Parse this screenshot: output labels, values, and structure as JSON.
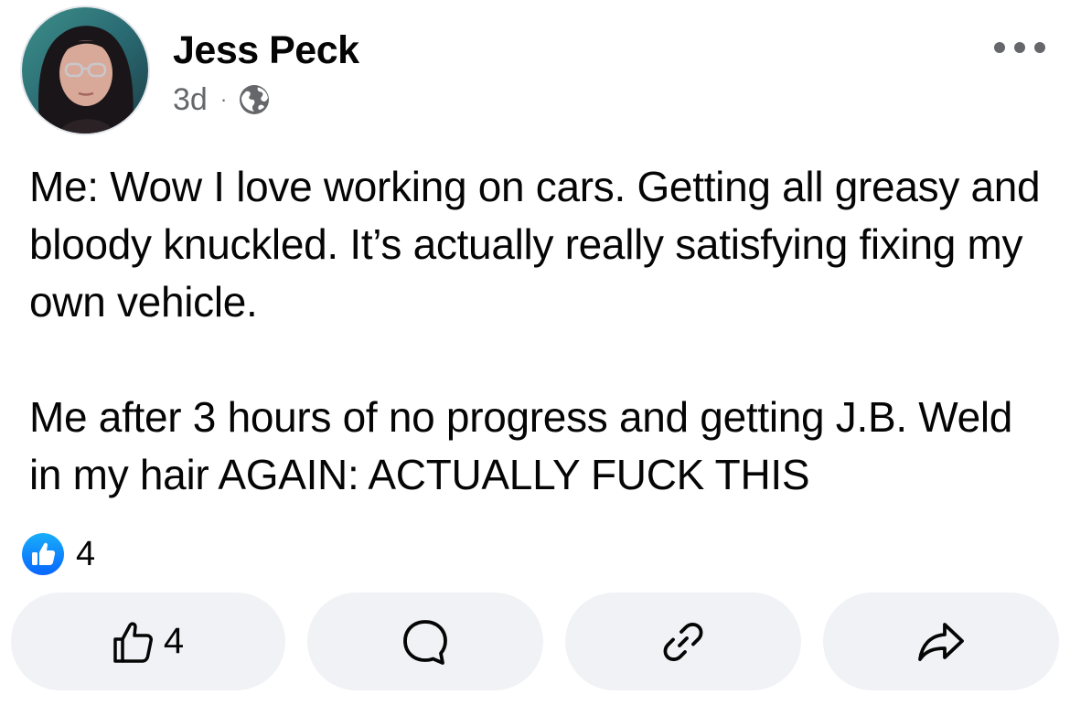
{
  "post": {
    "author_name": "Jess Peck",
    "timestamp": "3d",
    "separator": "·",
    "audience_icon": "globe-icon",
    "more_icon": "more-horizontal-icon",
    "paragraphs": [
      "Me: Wow I love working on cars. Getting all greasy and bloody knuckled. It’s actually really satisfying fixing my own vehicle.",
      "Me after 3 hours of no progress and getting J.B. Weld in my hair AGAIN: ACTUALLY FUCK THIS"
    ]
  },
  "reactions": {
    "icon": "like-badge-icon",
    "count": "4"
  },
  "actions": {
    "like": {
      "icon": "thumbs-up-icon",
      "count": "4"
    },
    "comment": {
      "icon": "comment-icon"
    },
    "link": {
      "icon": "link-icon"
    },
    "share": {
      "icon": "share-icon"
    }
  },
  "colors": {
    "like_blue": "#1877f2",
    "secondary_text": "#65676b",
    "button_bg": "#f0f2f5"
  }
}
